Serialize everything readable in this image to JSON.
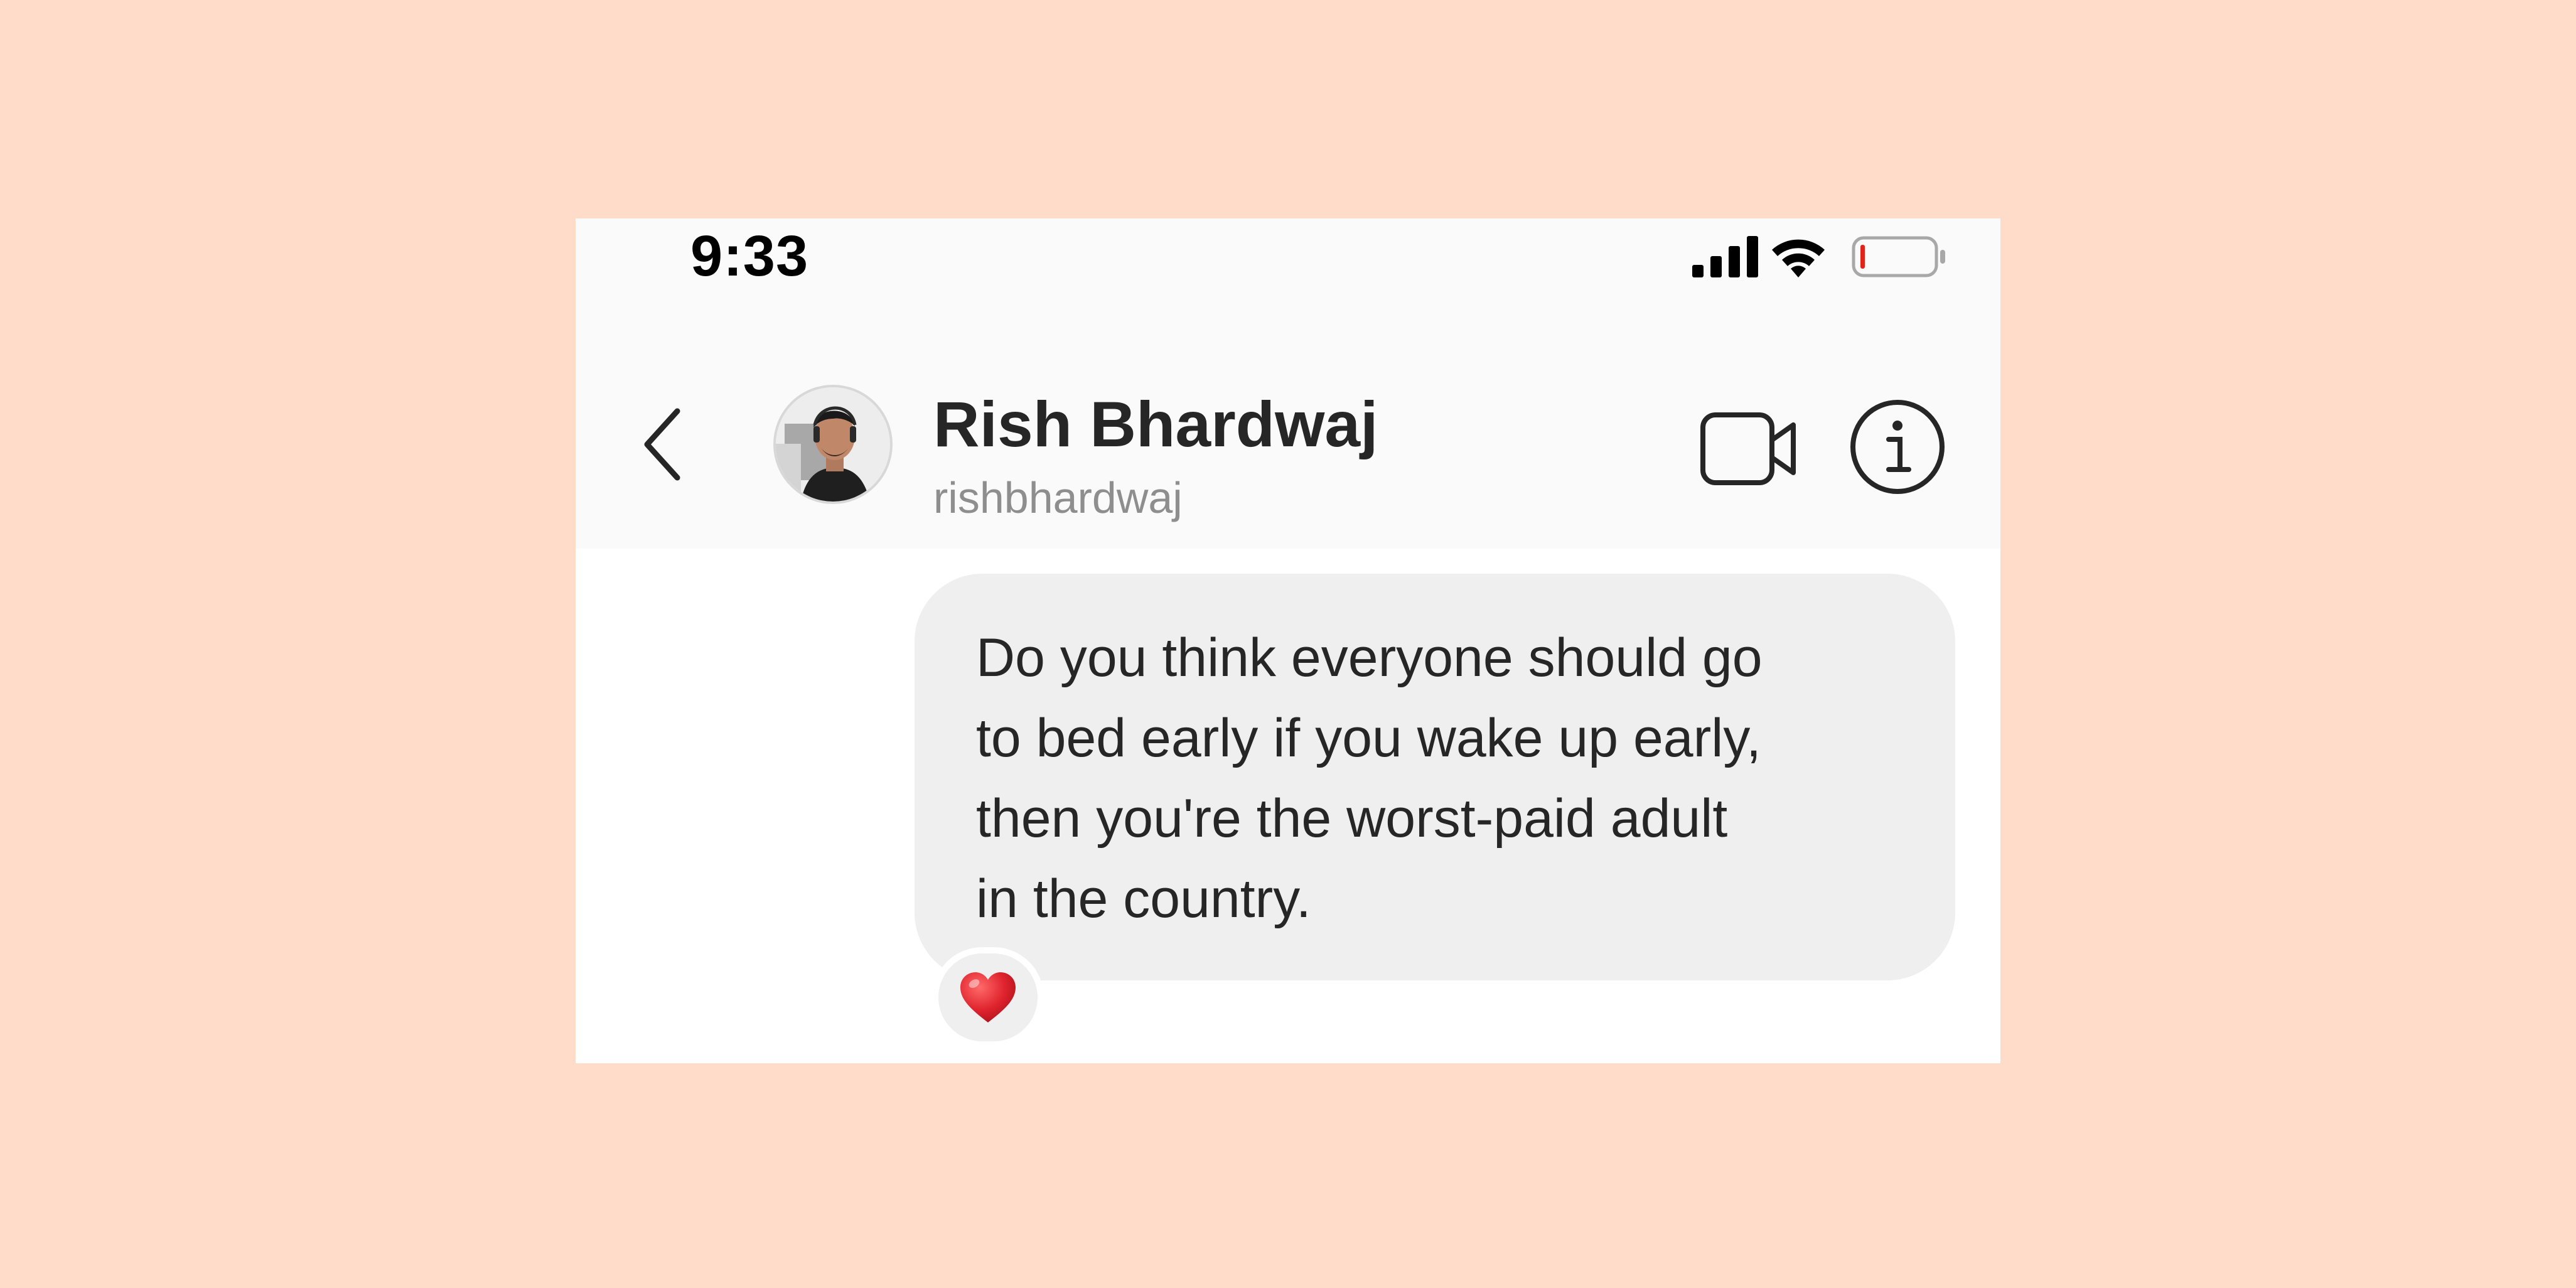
{
  "status_bar": {
    "time": "9:33"
  },
  "header": {
    "contact_name": "Rish Bhardwaj",
    "contact_username": "rishbhardwaj"
  },
  "messages": [
    {
      "text": "Do you think everyone should go\nto bed early if you wake up early,\nthen you're the worst-paid adult\nin the country.",
      "reaction": "heart-icon"
    }
  ],
  "colors": {
    "background": "#FFDCCA",
    "header_background": "#FAFAFA",
    "bubble": "#EFEFEF",
    "heart": "#E0242E",
    "battery_low": "#E2231A"
  },
  "icons": {
    "back": "chevron-left-icon",
    "video": "video-camera-icon",
    "info": "info-icon",
    "signal": "signal-icon",
    "wifi": "wifi-icon",
    "battery": "battery-icon"
  }
}
